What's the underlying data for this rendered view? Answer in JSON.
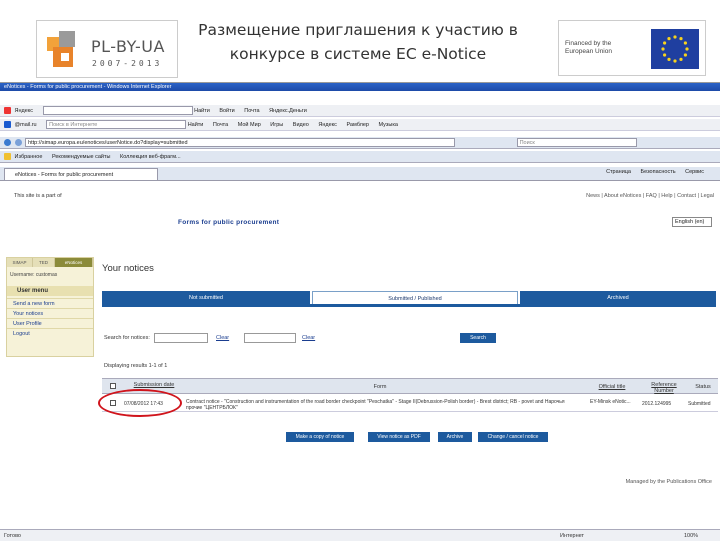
{
  "slide": {
    "title": "Размещение приглашения к участию в конкурсе в системе ЕС e-Notice",
    "pl_logo": {
      "name": "PL-BY-UA",
      "years": "2007-2013"
    },
    "eu_logo": {
      "text": "Financed by the European Union"
    }
  },
  "browser": {
    "window_title": "eNotices - Forms for public procurement - Windows Internet Explorer",
    "toolbar1": [
      "Яндекс",
      "Найти",
      "Войти",
      "Почта",
      "Яндекс.Деньги"
    ],
    "toolbar2": [
      "@mail.ru",
      "Поиск в Интернете",
      "Найти",
      "Почта",
      "Мой Мир",
      "Игры",
      "Видео",
      "Яндекс",
      "Рамблер",
      "Музыка"
    ],
    "address_url": "http://simap.europa.eu/enotices/userNotice.do?display=submitted",
    "search_placeholder": "Поиск",
    "favorites": [
      "Избранное",
      "Рекомендуемые сайты",
      "Коллекция веб-фрагм..."
    ],
    "tab_title": "eNotices - Forms for public procurement",
    "tools": [
      "Страница",
      "Безопасность",
      "Сервис"
    ],
    "status_left": "Готово",
    "status_right": "Интернет",
    "zoom": "100%"
  },
  "page": {
    "site_part": "This site is a part of",
    "top_links": "News | About eNotices | FAQ | Help | Contact | Legal",
    "forms_title": "Forms for public procurement",
    "language": "English (en)",
    "left_tabs": [
      "SIMAP",
      "TED",
      "eNotices"
    ],
    "username_label": "Username: customas",
    "user_menu_title": "User menu",
    "user_menu": [
      "Send a new form",
      "Your notices",
      "User Profile",
      "Logout"
    ],
    "your_notices": "Your notices",
    "tabs": [
      "Not submitted",
      "Submitted / Published",
      "Archived"
    ],
    "search_label": "Search for notices:",
    "clear_label": "Clear",
    "search_button": "Search",
    "results_count": "Displaying results 1-1 of 1",
    "columns": [
      "Submission date",
      "Form",
      "Official title",
      "Reference Number",
      "Status"
    ],
    "rows": [
      {
        "date": "07/08/2012 17:43",
        "form": "Contract notice - \"Construction and instrumentation of the road border checkpoint \"Peschatka\" - Stage II(Debrussion-Polish border) - Brest district; RB - povet and Нарочья прочие \"ЦЕНТРБЛОК\"",
        "title": "EY-Minsk eNotic...",
        "reference": "2012.124995",
        "status": "Submitted"
      }
    ],
    "actions": [
      "Make a copy of notice",
      "View notice as PDF",
      "Archive",
      "Change / cancel notice"
    ],
    "managed_by": "Managed by the Publications Office"
  },
  "colors": {
    "accent": "#1d5a9e",
    "highlight": "#d0141c"
  }
}
